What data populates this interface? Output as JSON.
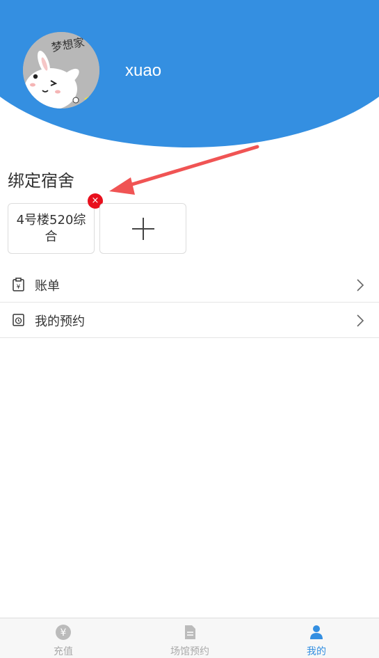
{
  "profile": {
    "username": "xuao",
    "avatar_text": "梦想家"
  },
  "dorm_section": {
    "title": "绑定宿舍",
    "dorm_card_label": "4号楼520综合",
    "remove_symbol": "×",
    "add_icon": "plus-icon"
  },
  "menu": [
    {
      "label": "账单",
      "icon": "bill-icon"
    },
    {
      "label": "我的预约",
      "icon": "reservation-icon"
    }
  ],
  "tabbar": {
    "tabs": [
      {
        "label": "充值",
        "icon": "yen-coin-icon",
        "active": false
      },
      {
        "label": "场馆预约",
        "icon": "document-icon",
        "active": false
      },
      {
        "label": "我的",
        "icon": "person-icon",
        "active": true
      }
    ]
  },
  "colors": {
    "primary": "#348fe1",
    "badge": "#e8101d",
    "annotation_arrow": "#f05454",
    "inactive_tab": "#aaaaaa"
  }
}
